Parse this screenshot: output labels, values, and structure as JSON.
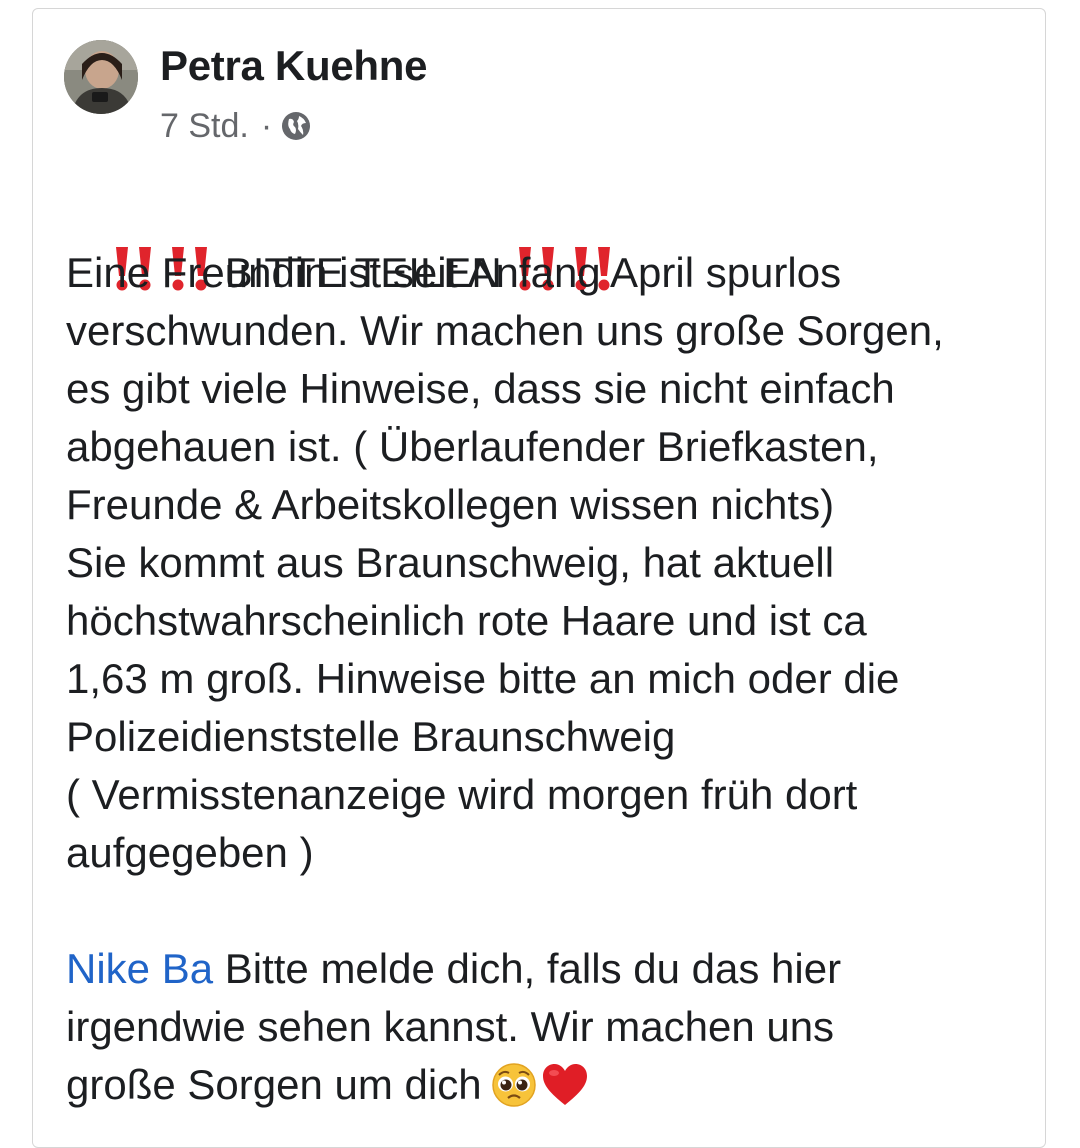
{
  "post": {
    "author": "Petra Kuehne",
    "time": "7 Std.",
    "separator": "·",
    "visibility_icon": "globe-icon",
    "headline_text": "BITTE TEILEN",
    "headline_icon": "double-exclamation-icon",
    "lines": [
      "Eine Freundin ist seit Anfang April spurlos",
      "verschwunden. Wir machen uns große Sorgen,",
      "es gibt viele Hinweise, dass sie nicht einfach",
      "abgehauen ist. ( Überlaufender Briefkasten,",
      "Freunde & Arbeitskollegen wissen nichts)",
      "Sie kommt aus Braunschweig, hat aktuell",
      "höchstwahrscheinlich rote Haare und ist ca",
      "1,63 m groß. Hinweise bitte an mich oder die",
      "Polizeidienststelle Braunschweig",
      "( Vermisstenanzeige wird morgen früh dort",
      "aufgegeben )"
    ],
    "mention": "Nike Ba",
    "mention_rest": " Bitte melde dich, falls du das hier",
    "lines2": [
      "irgendwie sehen kannst. Wir machen uns",
      "große Sorgen um dich"
    ],
    "end_emojis": [
      "pleading-face-emoji",
      "red-heart-emoji"
    ]
  },
  "colors": {
    "mention": "#2064c8",
    "exclamation": "#e0242c",
    "meta": "#65676b"
  }
}
